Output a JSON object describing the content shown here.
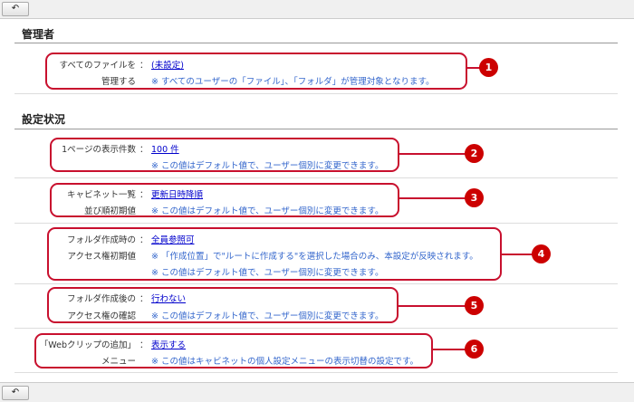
{
  "nav": {
    "back_icon": "↶"
  },
  "sections": [
    {
      "title": "管理者"
    },
    {
      "title": "設定状況"
    }
  ],
  "rows": [
    {
      "label1": "すべてのファイルを",
      "label2": "管理する",
      "colon": "：",
      "value": "(未設定)",
      "notes": [
        "※ すべてのユーザーの「ファイル」、「フォルダ」が管理対象となります。"
      ],
      "callout": "1"
    },
    {
      "label1": "1ページの表示件数",
      "label2": "",
      "colon": "：",
      "value": "100 件",
      "notes": [
        "※ この値はデフォルト値で、ユーザー個別に変更できます。"
      ],
      "callout": "2"
    },
    {
      "label1": "キャビネット一覧",
      "label2": "並び順初期値",
      "colon": "：",
      "value": "更新日時降順",
      "notes": [
        "※ この値はデフォルト値で、ユーザー個別に変更できます。"
      ],
      "callout": "3"
    },
    {
      "label1": "フォルダ作成時の",
      "label2": "アクセス権初期値",
      "colon": "：",
      "value": "全員参照可",
      "notes": [
        "※ 「作成位置」で\"ルートに作成する\"を選択した場合のみ、本設定が反映されます。",
        "※ この値はデフォルト値で、ユーザー個別に変更できます。"
      ],
      "callout": "4"
    },
    {
      "label1": "フォルダ作成後の",
      "label2": "アクセス権の確認",
      "colon": "：",
      "value": "行わない",
      "notes": [
        "※ この値はデフォルト値で、ユーザー個別に変更できます。"
      ],
      "callout": "5"
    },
    {
      "label1": "「Webクリップの追加」",
      "label2": "メニュー",
      "colon": "：",
      "value": "表示する",
      "notes": [
        "※ この値はキャビネットの個人設定メニューの表示切替の設定です。"
      ],
      "callout": "6"
    }
  ],
  "colors": {
    "callout": "#c8102e",
    "link": "#0000cc",
    "note": "#3366cc"
  }
}
